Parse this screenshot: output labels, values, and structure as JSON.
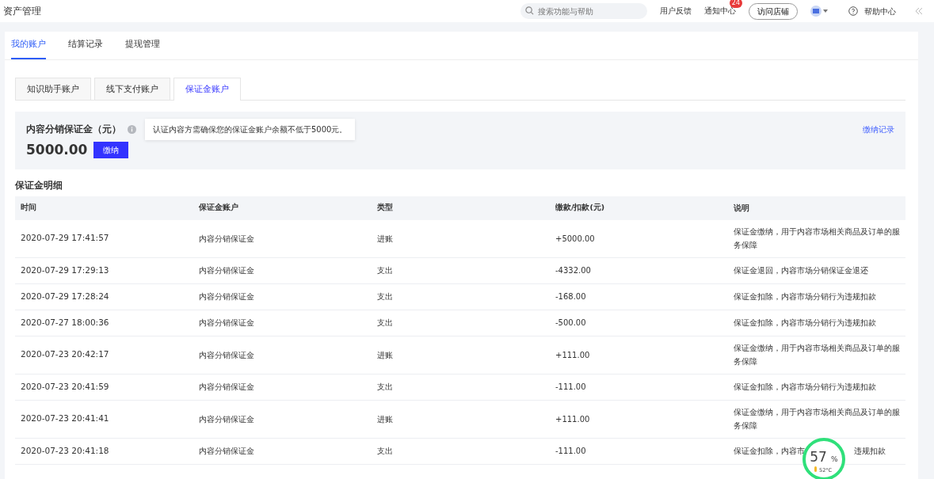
{
  "header": {
    "title": "资产管理",
    "search": {
      "placeholder": "搜索功能与帮助"
    },
    "links": [
      "用户反馈",
      "通知中心"
    ],
    "notification_count": "24",
    "visit_button": "访问店铺",
    "help": "帮助中心"
  },
  "main_tabs": [
    {
      "label": "我的账户",
      "selected": true
    },
    {
      "label": "结算记录",
      "selected": false
    },
    {
      "label": "提现管理",
      "selected": false
    }
  ],
  "account_tabs": [
    {
      "label": "知识助手账户",
      "selected": false
    },
    {
      "label": "线下支付账户",
      "selected": false
    },
    {
      "label": "保证金账户",
      "selected": true
    }
  ],
  "deposit": {
    "title": "内容分销保证金（元）",
    "tooltip": "认证内容方需确保您的保证金账户余额不低于5000元。",
    "amount": "5000.00",
    "pay_button": "缴纳",
    "records_link": "缴纳记录"
  },
  "details": {
    "title": "保证金明细",
    "columns": [
      "时间",
      "保证金账户",
      "类型",
      "缴款/扣款(元)",
      "说明"
    ],
    "rows": [
      [
        "2020-07-29 17:41:57",
        "内容分销保证金",
        "进账",
        "+5000.00",
        "保证金缴纳，用于内容市场相关商品及订单的服务保障"
      ],
      [
        "2020-07-29 17:29:13",
        "内容分销保证金",
        "支出",
        "-4332.00",
        "保证金退回，内容市场分销保证金退还"
      ],
      [
        "2020-07-29 17:28:24",
        "内容分销保证金",
        "支出",
        "-168.00",
        "保证金扣除，内容市场分销行为违规扣款"
      ],
      [
        "2020-07-27 18:00:36",
        "内容分销保证金",
        "支出",
        "-500.00",
        "保证金扣除，内容市场分销行为违规扣款"
      ],
      [
        "2020-07-23 20:42:17",
        "内容分销保证金",
        "进账",
        "+111.00",
        "保证金缴纳，用于内容市场相关商品及订单的服务保障"
      ],
      [
        "2020-07-23 20:41:59",
        "内容分销保证金",
        "支出",
        "-111.00",
        "保证金扣除，内容市场分销行为违规扣款"
      ],
      [
        "2020-07-23 20:41:41",
        "内容分销保证金",
        "进账",
        "+111.00",
        "保证金缴纳，用于内容市场相关商品及订单的服务保障"
      ],
      [
        "2020-07-23 20:41:18",
        "内容分销保证金",
        "支出",
        "-111.00",
        [
          "保证金扣除，内容市",
          "违规扣款"
        ]
      ]
    ]
  },
  "monitor_widget": {
    "value": "57",
    "unit": "%",
    "temperature": "52°C"
  }
}
